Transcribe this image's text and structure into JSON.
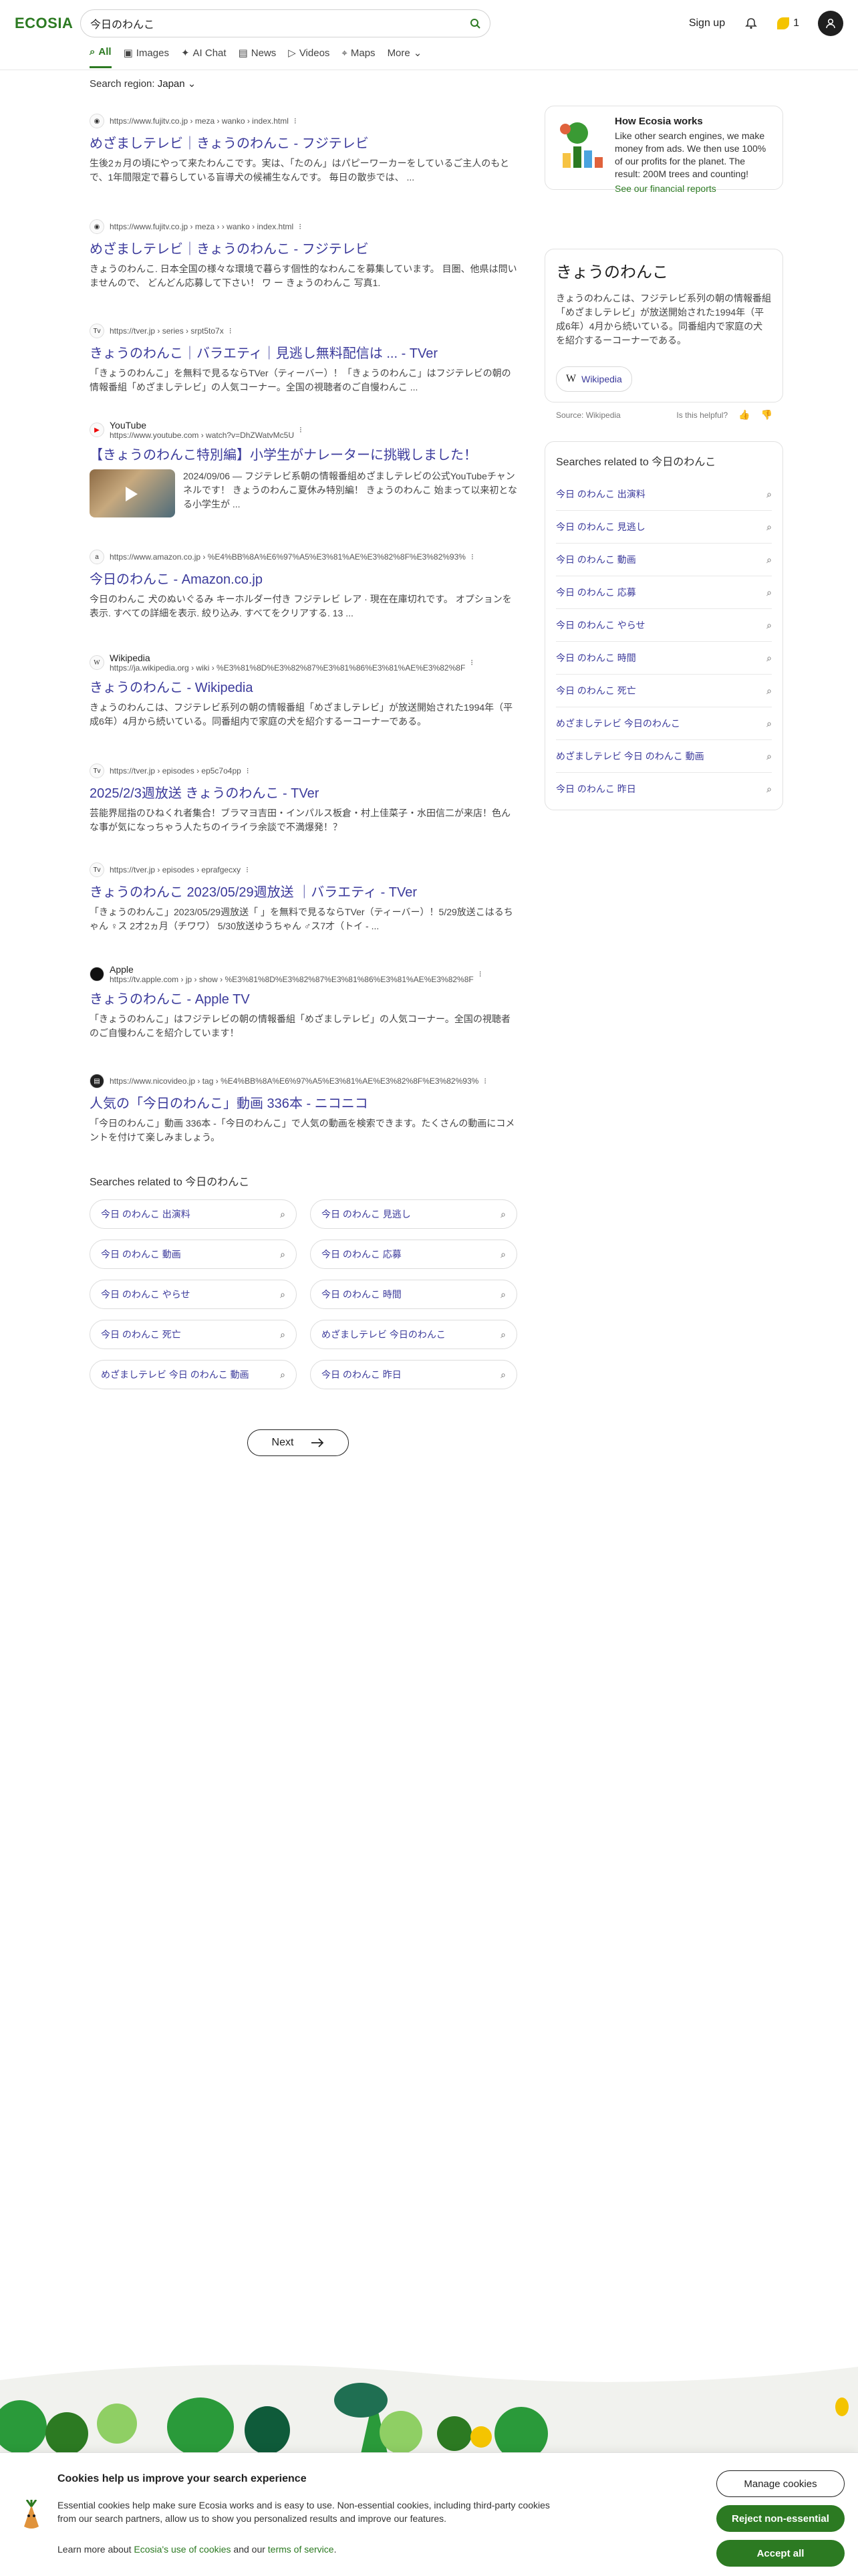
{
  "header": {
    "logo": "ECOSIA",
    "search_query": "今日のわんこ",
    "signup_label": "Sign up",
    "seed_count": "1",
    "tabs": [
      {
        "label": "All",
        "icon": "search-icon"
      },
      {
        "label": "Images",
        "icon": "image-icon"
      },
      {
        "label": "AI Chat",
        "icon": "chat-icon"
      },
      {
        "label": "News",
        "icon": "news-icon"
      },
      {
        "label": "Videos",
        "icon": "play-icon"
      },
      {
        "label": "Maps",
        "icon": "map-pin-icon"
      },
      {
        "label": "More",
        "icon": "chevron-down-icon"
      }
    ],
    "region_label": "Search region:",
    "region_value": "Japan"
  },
  "results": [
    {
      "site": "",
      "url": "https://www.fujitv.co.jp › meza › wanko › index.html",
      "title": "めざましテレビ｜きょうのわんこ - フジテレビ",
      "snippet": "生後2ヵ月の頃にやって来たわんこです。実は、「たのん」はパピーワーカーをしているご主人のもとで、1年間限定で暮らしている盲導犬の候補生なんです。 毎日の散歩では、 ..."
    },
    {
      "site": "",
      "url": "https://www.fujitv.co.jp › meza › › wanko › index.html",
      "title": "めざましテレビ｜きょうのわんこ - フジテレビ",
      "snippet": "きょうのわんこ. 日本全国の様々な環境で暮らす個性的なわんこを募集しています。 目圏、他県は問いませんので、 どんどん応募して下さい！ ワ ー きょうのわんこ 写真1."
    },
    {
      "site": "",
      "url": "https://tver.jp › series › srpt5to7x",
      "title": "きょうのわんこ｜バラエティ｜見逃し無料配信は ... - TVer",
      "snippet": "「きょうのわんこ」を無料で見るならTVer（ティーバー）！「きょうのわんこ」はフジテレビの朝の情報番組「めざましテレビ」の人気コーナー。全国の視聴者のご自慢わんこ ..."
    },
    {
      "site": "YouTube",
      "url": "https://www.youtube.com › watch?v=DhZWatvMc5U",
      "title": "【きょうのわんこ特別編】小学生がナレーターに挑戦しました！",
      "snippet": "2024/09/06 — フジテレビ系朝の情報番組めざましテレビの公式YouTubeチャンネルです！ きょうのわんこ夏休み特別編！ きょうのわんこ 始まって以来初となる小学生が ..."
    },
    {
      "site": "",
      "url": "https://www.amazon.co.jp › %E4%BB%8A%E6%97%A5%E3%81%AE%E3%82%8F%E3%82%93%",
      "title": "今日のわんこ - Amazon.co.jp",
      "snippet": "今日のわんこ 犬のぬいぐるみ キーホルダー付き フジテレビ レア · 現在在庫切れです。 オプションを表示. すべての詳細を表示. 絞り込み. すべてをクリアする. 13 ..."
    },
    {
      "site": "Wikipedia",
      "url": "https://ja.wikipedia.org › wiki › %E3%81%8D%E3%82%87%E3%81%86%E3%81%AE%E3%82%8F",
      "title": "きょうのわんこ - Wikipedia",
      "snippet": "きょうのわんこは、フジテレビ系列の朝の情報番組「めざましテレビ」が放送開始された1994年（平成6年）4月から続いている。同番組内で家庭の犬を紹介するーコーナーである。"
    },
    {
      "site": "",
      "url": "https://tver.jp › episodes › ep5c7o4pp",
      "title": "2025/2/3週放送 きょうのわんこ - TVer",
      "snippet": "芸能界屈指のひねくれ者集合！ブラマヨ吉田・インパルス板倉・村上佳菜子・水田信二が来店！色んな事が気になっちゃう人たちのイライラ余談で不満爆発！？"
    },
    {
      "site": "",
      "url": "https://tver.jp › episodes › eprafgecxy",
      "title": "きょうのわんこ 2023/05/29週放送 ｜バラエティ - TVer",
      "snippet": "「きょうのわんこ」2023/05/29週放送「 」を無料で見るならTVer（ティーバー）！5/29放送こはるちゃん ♀ス 2才2ヵ月（チワワ） 5/30放送ゆうちゃん ♂ス7才（トイ - ..."
    },
    {
      "site": "Apple",
      "url": "https://tv.apple.com › jp › show › %E3%81%8D%E3%82%87%E3%81%86%E3%81%AE%E3%82%8F",
      "title": "きょうのわんこ - Apple TV",
      "snippet": "「きょうのわんこ」はフジテレビの朝の情報番組「めざましテレビ」の人気コーナー。全国の視聴者のご自慢わんこを紹介しています！"
    },
    {
      "site": "",
      "url": "https://www.nicovideo.jp › tag › %E4%BB%8A%E6%97%A5%E3%81%AE%E3%82%8F%E3%82%93%",
      "title": "人気の「今日のわんこ」動画 336本 - ニコニコ",
      "snippet": "「今日のわんこ」動画 336本 -「今日のわんこ」で人気の動画を検索できます。たくさんの動画にコメントを付けて楽しみましょう。"
    }
  ],
  "related": {
    "title": "Searches related to 今日のわんこ",
    "items": [
      "今日 のわんこ 出演料",
      "今日 のわんこ 見逃し",
      "今日 のわんこ 動画",
      "今日 のわんこ 応募",
      "今日 のわんこ やらせ",
      "今日 のわんこ 時間",
      "今日 のわんこ 死亡",
      "めざましテレビ 今日のわんこ",
      "めざましテレビ 今日 のわんこ 動画",
      "今日 のわんこ 昨日"
    ]
  },
  "next_label": "Next",
  "sidebar": {
    "how": {
      "title": "How Ecosia works",
      "text": "Like other search engines, we make money from ads. We then use 100% of our profits for the planet. The result: 200M trees and counting!",
      "link": "See our financial reports"
    },
    "knowledge": {
      "title": "きょうのわんこ",
      "text": "きょうのわんこは、フジテレビ系列の朝の情報番組「めざましテレビ」が放送開始された1994年（平成6年）4月から続いている。同番組内で家庭の犬を紹介するーコーナーである。",
      "button": "Wikipedia",
      "source": "Source: Wikipedia",
      "helpful": "Is this helpful?"
    },
    "related_title": "Searches related to 今日のわんこ",
    "related_items": [
      "今日 のわんこ 出演料",
      "今日 のわんこ 見逃し",
      "今日 のわんこ 動画",
      "今日 のわんこ 応募",
      "今日 のわんこ やらせ",
      "今日 のわんこ 時間",
      "今日 のわんこ 死亡",
      "めざましテレビ 今日のわんこ",
      "めざましテレビ 今日 のわんこ 動画",
      "今日 のわんこ 昨日"
    ]
  },
  "cookie": {
    "title": "Cookies help us improve your search experience",
    "text": "Essential cookies help make sure Ecosia works and is easy to use. Non-essential cookies, including third-party cookies from our search partners, allow us to show you personalized results and improve our features.",
    "learn_prefix": "Learn more about",
    "learn_link1": "Ecosia's use of cookies",
    "learn_and": "and our",
    "learn_link2": "terms of service",
    "learn_suffix": ".",
    "manage": "Manage cookies",
    "reject": "Reject non-essential",
    "accept": "Accept all"
  },
  "colors": {
    "brand_green": "#2c7a22",
    "link_purple": "#3b3a9b"
  }
}
